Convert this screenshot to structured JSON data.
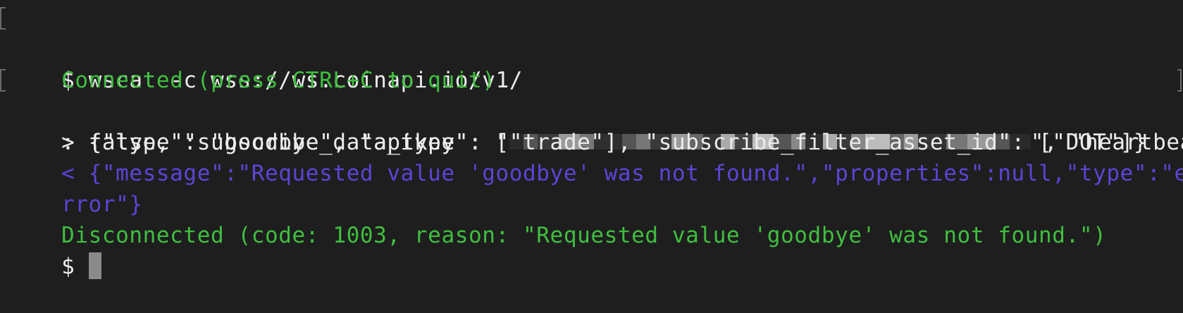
{
  "lines": [
    {
      "text": "$ wscat -c wss://ws.coinapi.io/v1/",
      "color": "#ececec"
    },
    {
      "text": "Connected (press CTRL+C to quit)",
      "color": "#3fbf3f"
    },
    {
      "text_before_redaction": "> {\"type\": \"goodbye\", \"apikey\": \"",
      "text_after_redaction": "\", \"heartbeat\"",
      "color": "#ececec"
    },
    {
      "text": ": false, \"subscribe_data_type\": [\"trade\"], \"subscribe_filter_asset_id\": [\"DOT\"]}",
      "color": "#ececec"
    },
    {
      "text": "< {\"message\":\"Requested value 'goodbye' was not found.\",\"properties\":null,\"type\":\"e",
      "color": "#5b45d6"
    },
    {
      "text": "rror\"}",
      "color": "#5b45d6"
    },
    {
      "text": "Disconnected (code: 1003, reason: \"Requested value 'goodbye' was not found.\")",
      "color": "#3fbf3f"
    },
    {
      "text": "$ ",
      "color": "#ececec"
    }
  ]
}
